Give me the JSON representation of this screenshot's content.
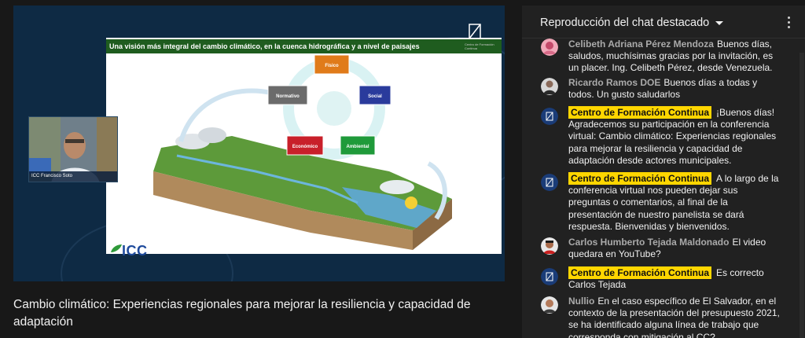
{
  "video": {
    "slide_title": "Una visión más integral del cambio climático, en la cuenca hidrográfica y a nivel de paisajes",
    "logo_text": "Centro de Formación Continua",
    "circle_nodes": [
      "Físico",
      "Normativo",
      "Social",
      "Económico",
      "Ambiental"
    ],
    "webcam_label": "ICC Francisco Soto",
    "brand_logo": "ICC",
    "title": "Cambio climático: Experiencias regionales para mejorar la resiliencia y capacidad de adaptación"
  },
  "chat": {
    "header": "Reproducción del chat destacado",
    "messages": [
      {
        "author": "Celibeth Adriana Pérez Mendoza",
        "text": "Buenos días, saludos, muchísimas gracias por la invitación, es un placer. Ing. Celibeth Pérez, desde Venezuela.",
        "badge": false
      },
      {
        "author": "Ricardo Ramos DOE",
        "text": "Buenos días a todas y todos. Un gusto saludarlos",
        "badge": false
      },
      {
        "author": "Centro de Formación Continua",
        "text": "¡Buenos días! Agradecemos su participación en la conferencia virtual: Cambio climático: Experiencias regionales para mejorar la resiliencia y capacidad de adaptación desde actores municipales.",
        "badge": true
      },
      {
        "author": "Centro de Formación Continua",
        "text": "A lo largo de la conferencia virtual nos pueden dejar sus preguntas o comentarios, al final de la presentación de nuestro panelista se dará respuesta. Bienvenidas y bienvenidos.",
        "badge": true
      },
      {
        "author": "Carlos Humberto Tejada Maldonado",
        "text": "El video quedara en YouTube?",
        "badge": false
      },
      {
        "author": "Centro de Formación Continua",
        "text": "Es correcto Carlos Tejada",
        "badge": true
      },
      {
        "author": "Nullio",
        "text": "En el caso específico de El Salvador, en el contexto de la presentación del presupuesto 2021, se ha identificado alguna línea de trabajo que corresponda con mitigación al CC?",
        "badge": false
      }
    ]
  },
  "colors": {
    "badge": "#ffd600",
    "slide_header": "#1f5c1f",
    "chat_bg": "#212121",
    "page_bg": "#181818",
    "node_fisico": "#e07b1a",
    "node_normativo": "#6b6b6b",
    "node_social": "#2a3b9c",
    "node_economico": "#c8202a",
    "node_ambiental": "#1f9a3a"
  }
}
